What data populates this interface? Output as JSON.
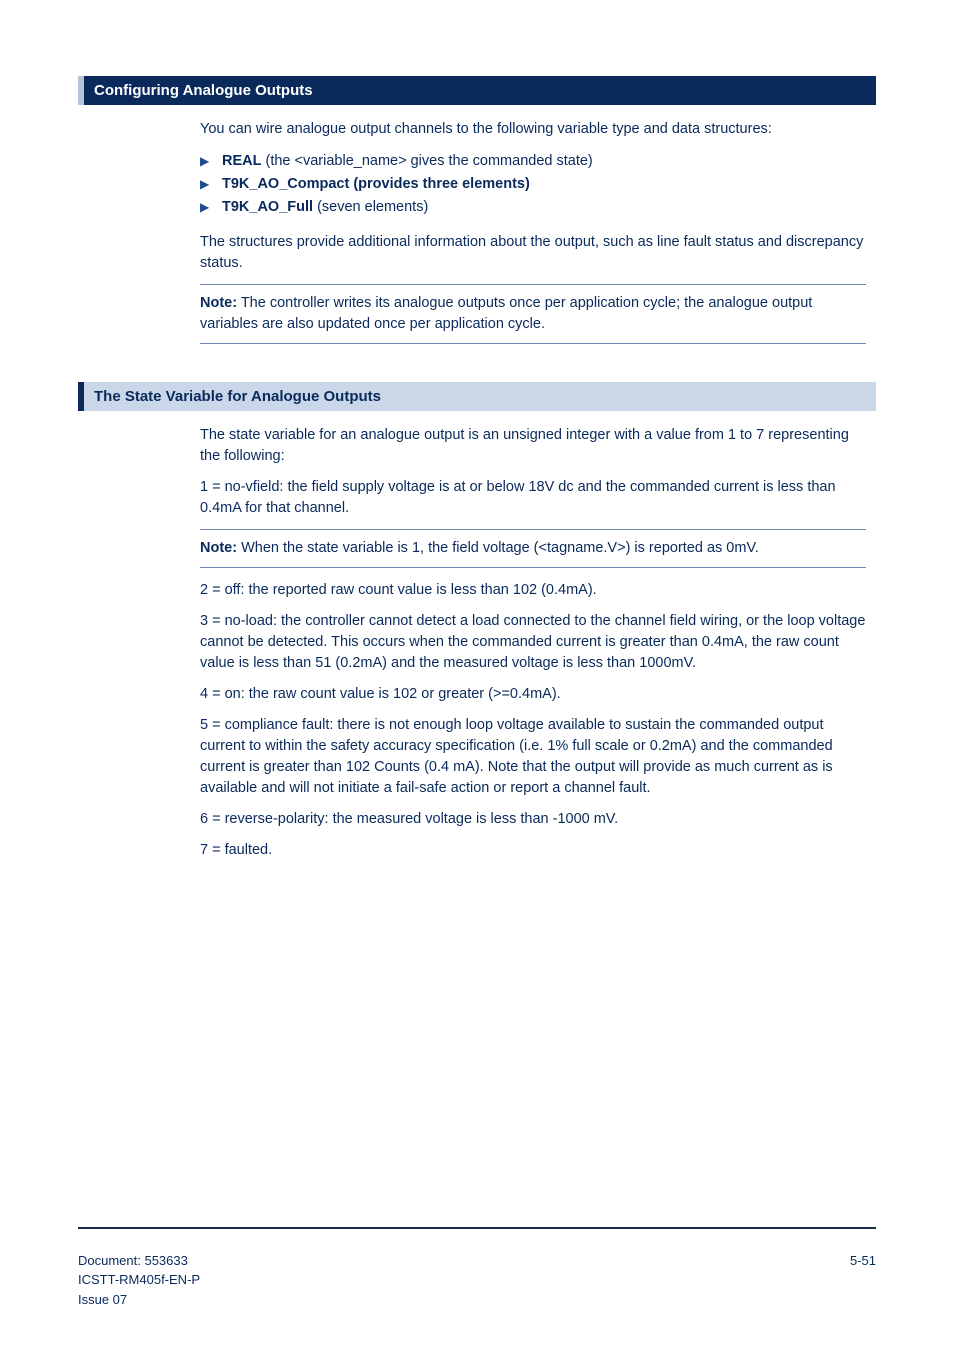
{
  "section1": {
    "title": "Configuring Analogue Outputs",
    "intro": "You can wire analogue output channels to the following variable type and data structures:",
    "bullets": [
      {
        "b": "REAL",
        "t": " (the <variable_name> gives the commanded state)"
      },
      {
        "b": "T9K_AO_Compact (provides three elements)",
        "t": ""
      },
      {
        "b": "T9K_AO_Full",
        "t": " (seven elements)"
      }
    ],
    "after": "The structures provide additional information about the output, such as line fault status and discrepancy status.",
    "note_label": "Note:",
    "note_body": " The controller writes its analogue outputs once per application cycle; the analogue output variables are also updated once per application cycle."
  },
  "section2": {
    "title": "The State Variable for Analogue Outputs",
    "p1": "The state variable for an analogue output is an unsigned integer with a value from 1 to 7 representing the following:",
    "p2": "1 = no-vfield: the field supply voltage is at or below 18V dc and the commanded current is less than 0.4mA for that channel.",
    "note_label": "Note:",
    "note_body": " When the state variable is 1, the field voltage (<tagname.V>) is reported as 0mV.",
    "p3": "2 = off: the reported raw count value is less than 102 (0.4mA).",
    "p4": "3 = no-load: the controller cannot detect a load connected to the channel field wiring, or the loop voltage cannot be detected. This occurs when the commanded current is greater than 0.4mA, the raw count value is less than 51 (0.2mA) and the measured voltage is less than 1000mV.",
    "p5": "4 = on: the raw count value is 102 or greater (>=0.4mA).",
    "p6": "5 = compliance fault: there is not enough loop voltage available to sustain the commanded output current to within the safety accuracy specification (i.e. 1% full scale or 0.2mA) and the commanded current is greater than 102 Counts (0.4 mA). Note that the output will provide as much current as is available and will not initiate a fail-safe action or report a channel fault.",
    "p7": "6 = reverse-polarity: the measured voltage is less than -1000 mV.",
    "p8": "7 = faulted."
  },
  "footer": {
    "doc_label": "Document: 553633",
    "doc_code": "ICSTT-RM405f-EN-P",
    "issue": "Issue 07",
    "page": "5-51"
  }
}
